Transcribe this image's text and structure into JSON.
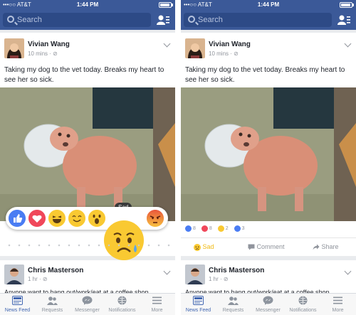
{
  "status": {
    "carrier": "•••○○ AT&T",
    "time": "1:44 PM"
  },
  "search": {
    "placeholder": "Search"
  },
  "post": {
    "author": "Vivian Wang",
    "meta": "10 mins · ⊘",
    "text": "Taking my dog to the vet today. Breaks my heart to see her so sick."
  },
  "reactions": {
    "tooltip": "Sad",
    "icons": [
      "like-icon",
      "love-icon",
      "haha-icon",
      "yay-icon",
      "wow-icon",
      "sad-icon",
      "angry-icon"
    ]
  },
  "summary": {
    "counts": [
      {
        "icon": "like-icon",
        "value": "8",
        "color": "#4a7df3"
      },
      {
        "icon": "love-icon",
        "value": "8",
        "color": "#f0475a"
      },
      {
        "icon": "sad-icon",
        "value": "2",
        "color": "#f9c932"
      },
      {
        "icon": "comment-icon",
        "value": "3",
        "color": "#4a7df3"
      }
    ]
  },
  "actions": {
    "sad": "Sad",
    "comment": "Comment",
    "share": "Share"
  },
  "next_post": {
    "author": "Chris Masterson",
    "meta": "1 hr · ⊘",
    "text": "Anyone want to hang out/work/eat at a coffee shop"
  },
  "tabs": [
    {
      "label": "News Feed",
      "icon": "news-feed-icon"
    },
    {
      "label": "Requests",
      "icon": "requests-icon"
    },
    {
      "label": "Messenger",
      "icon": "messenger-icon"
    },
    {
      "label": "Notifications",
      "icon": "notifications-icon"
    },
    {
      "label": "More",
      "icon": "more-icon"
    }
  ],
  "colors": {
    "brand": "#3b5998",
    "active_tab": "#4267b2",
    "sad": "#f0ba15"
  }
}
